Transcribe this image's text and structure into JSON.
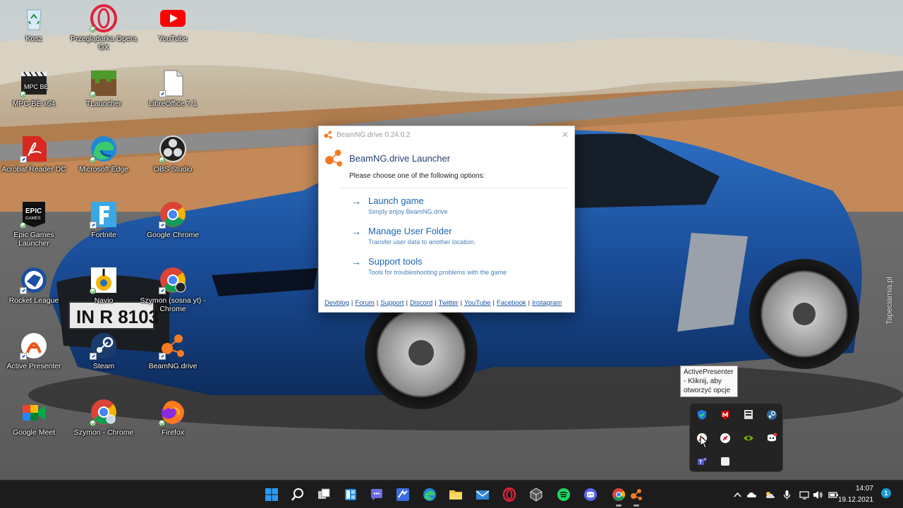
{
  "desktop": {
    "icons": [
      {
        "label": "Kosz",
        "icon": "recycle-bin-icon"
      },
      {
        "label": "Przeglądarka Opera GX",
        "icon": "opera-gx-icon"
      },
      {
        "label": "YouTube",
        "icon": "youtube-icon"
      },
      {
        "label": "MPC-BE x64",
        "icon": "mpc-be-icon"
      },
      {
        "label": "TLauncher",
        "icon": "tlauncher-icon"
      },
      {
        "label": "LibreOffice 7.1",
        "icon": "libreoffice-icon"
      },
      {
        "label": "Acrobat Reader DC",
        "icon": "acrobat-icon"
      },
      {
        "label": "Microsoft Edge",
        "icon": "edge-icon"
      },
      {
        "label": "OBS Studio",
        "icon": "obs-icon"
      },
      {
        "label": "Epic Games Launcher",
        "icon": "epic-games-icon"
      },
      {
        "label": "Fortnite",
        "icon": "fortnite-icon"
      },
      {
        "label": "Google Chrome",
        "icon": "chrome-icon"
      },
      {
        "label": "Rocket League",
        "icon": "rocket-league-icon"
      },
      {
        "label": "Navio",
        "icon": "navio-icon"
      },
      {
        "label": "Szymon (sosna yt) - Chrome",
        "icon": "chrome-profile-icon"
      },
      {
        "label": "Active Presenter",
        "icon": "active-presenter-icon"
      },
      {
        "label": "Steam",
        "icon": "steam-icon"
      },
      {
        "label": "BeamNG.drive",
        "icon": "beamng-icon"
      },
      {
        "label": "Google Meet",
        "icon": "google-meet-icon"
      },
      {
        "label": "Szymon - Chrome",
        "icon": "chrome-profile-icon"
      },
      {
        "label": "Firefox",
        "icon": "firefox-icon"
      }
    ]
  },
  "dialog": {
    "window_title": "BeamNG.drive 0.24.0.2",
    "header_title": "BeamNG.drive Launcher",
    "instruction": "Please choose one of the following options:",
    "options": [
      {
        "label": "Launch game",
        "description": "Simply enjoy BeamNG.drive"
      },
      {
        "label": "Manage User Folder",
        "description": "Transfer user data to another location."
      },
      {
        "label": "Support tools",
        "description": "Tools for troubleshooting problems with the game"
      }
    ],
    "links": [
      "Devblog",
      "Forum",
      "Support",
      "Discord",
      "Twitter",
      "YouTube",
      "Facebook",
      "Instagram"
    ],
    "close_glyph": "✕"
  },
  "tooltip": {
    "text": "ActivePresenter - Kliknij, aby otworzyć opcje"
  },
  "tray_overflow": {
    "icons": [
      "windows-security-icon",
      "mcafee-icon",
      "epic-games-tray-icon",
      "steam-tray-icon",
      "active-presenter-tray-icon",
      "opera-tray-icon",
      "nvidia-icon",
      "discord-tray-icon",
      "teams-icon",
      "white-square-icon"
    ]
  },
  "taskbar": {
    "apps": [
      "start-icon",
      "search-icon",
      "task-view-icon",
      "widgets-icon",
      "teams-chat-icon",
      "visual-studio-icon",
      "edge-icon",
      "file-explorer-icon",
      "mail-icon",
      "opera-icon",
      "unity-icon",
      "spotify-icon",
      "discord-icon",
      "chrome-icon",
      "beamng-icon"
    ],
    "time": "14:07",
    "date": "19.12.2021",
    "notification_count": "1"
  },
  "watermark": {
    "text": "Tapeciarnia.pl"
  }
}
